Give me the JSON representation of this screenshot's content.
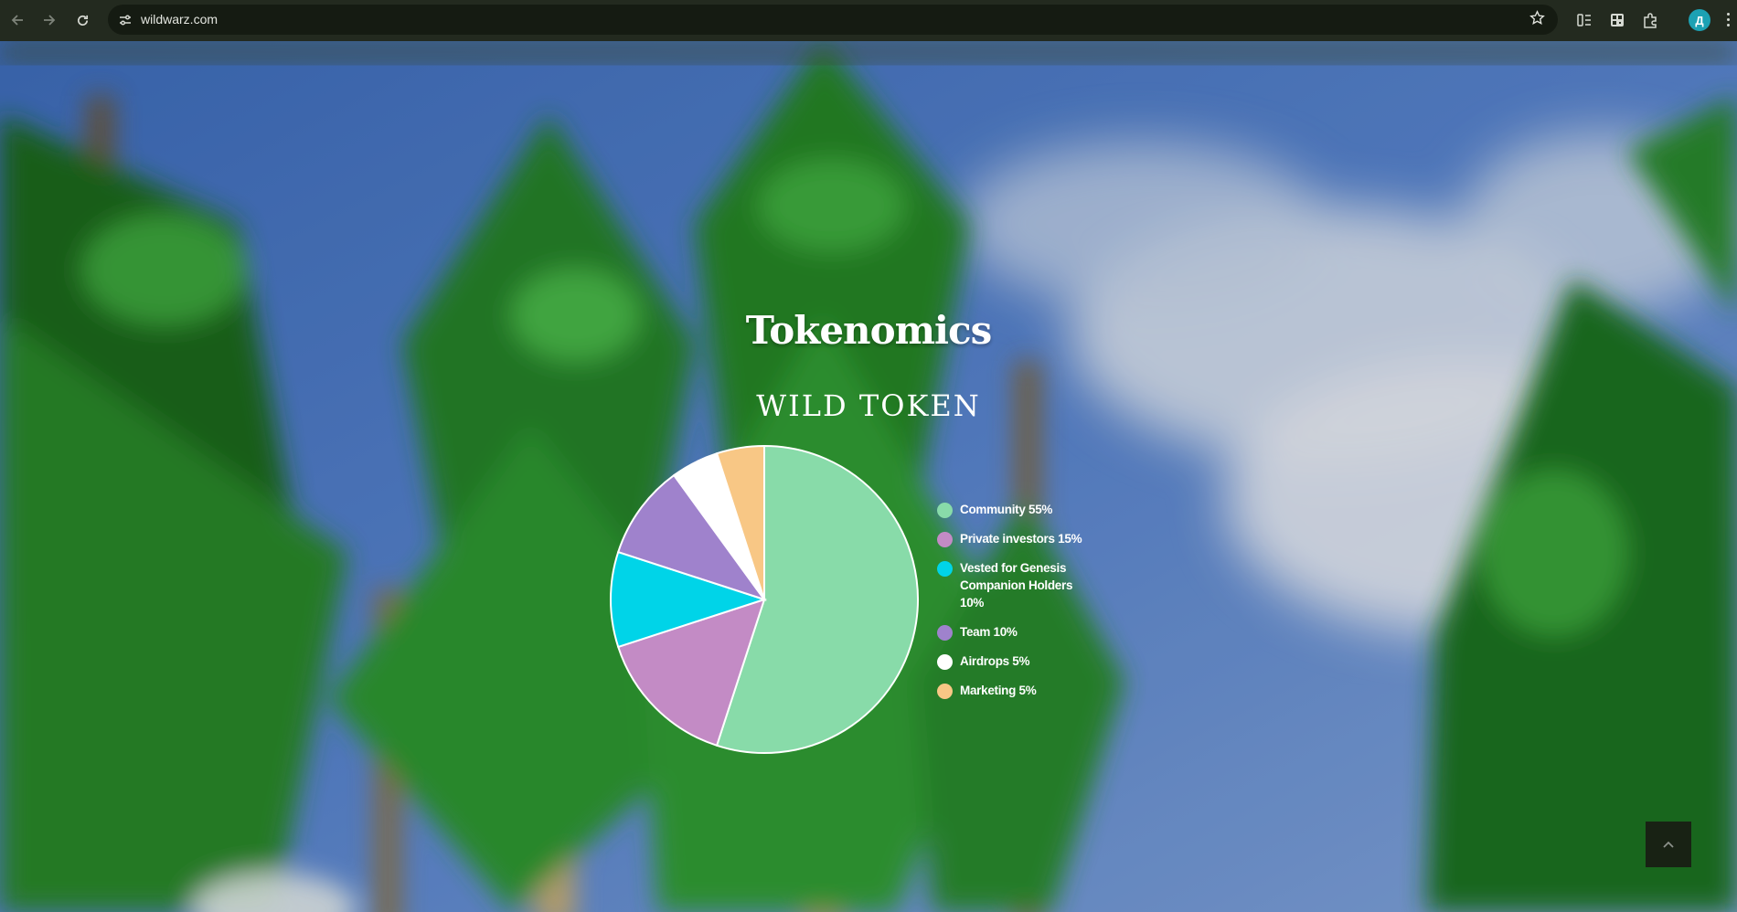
{
  "browser": {
    "url": "wildwarz.com",
    "profile_initial": "Д"
  },
  "page": {
    "title": "Tokenomics",
    "subtitle": "WILD TOKEN"
  },
  "chart_data": {
    "type": "pie",
    "title": "WILD TOKEN",
    "categories": [
      "Community",
      "Private investors",
      "Vested for Genesis Companion Holders",
      "Team",
      "Airdrops",
      "Marketing"
    ],
    "values": [
      55,
      15,
      10,
      10,
      5,
      5
    ],
    "labels": [
      "Community 55%",
      "Private investors 15%",
      "Vested for Genesis Companion Holders 10%",
      "Team 10%",
      "Airdrops 5%",
      "Marketing 5%"
    ],
    "colors": [
      "#88dba9",
      "#c38bc5",
      "#00d4e8",
      "#9f82cc",
      "#ffffff",
      "#f8c785"
    ],
    "legend": "right"
  },
  "icons": {
    "back": "arrow-left-icon",
    "forward": "arrow-right-icon",
    "reload": "reload-icon",
    "site_settings": "tune-icon",
    "bookmark": "star-icon",
    "scroll_top": "chevron-up-icon"
  }
}
